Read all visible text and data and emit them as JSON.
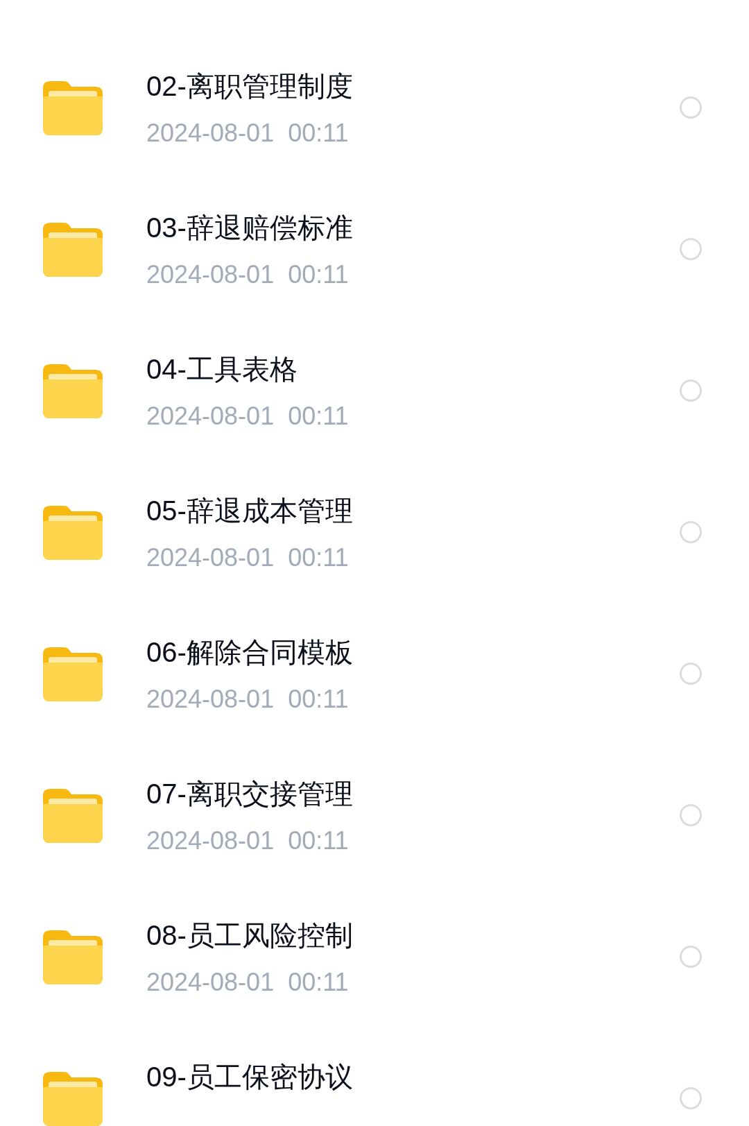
{
  "folders": [
    {
      "name": "02-离职管理制度",
      "date": "2024-08-01  00:11",
      "selected": false
    },
    {
      "name": "03-辞退赔偿标准",
      "date": "2024-08-01  00:11",
      "selected": false
    },
    {
      "name": "04-工具表格",
      "date": "2024-08-01  00:11",
      "selected": false
    },
    {
      "name": "05-辞退成本管理",
      "date": "2024-08-01  00:11",
      "selected": false
    },
    {
      "name": "06-解除合同模板",
      "date": "2024-08-01  00:11",
      "selected": false
    },
    {
      "name": "07-离职交接管理",
      "date": "2024-08-01  00:11",
      "selected": false
    },
    {
      "name": "08-员工风险控制",
      "date": "2024-08-01  00:11",
      "selected": false
    },
    {
      "name": "09-员工保密协议",
      "selected": false
    }
  ]
}
